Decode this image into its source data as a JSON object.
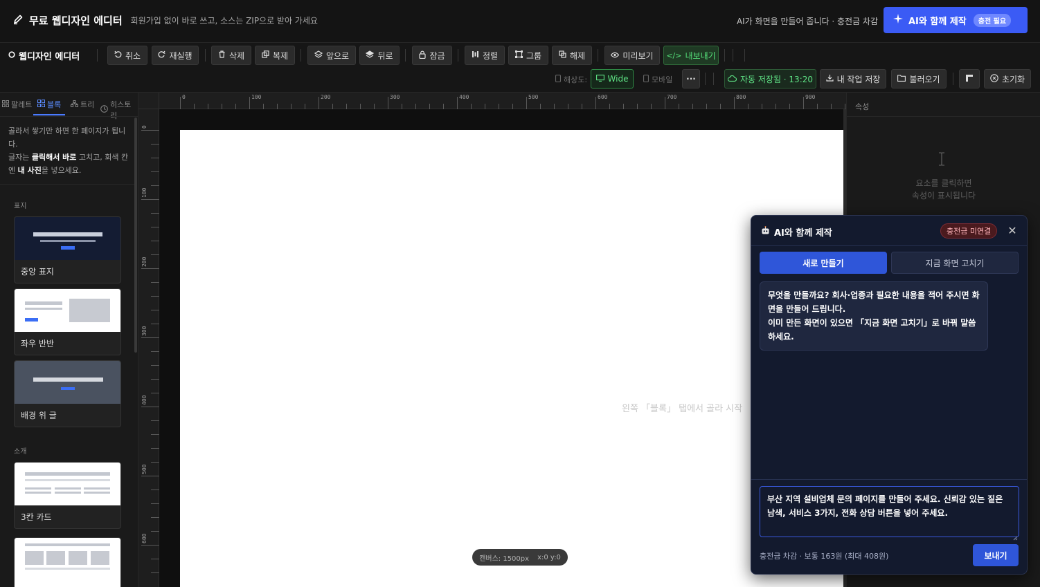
{
  "header": {
    "title": "무료 웹디자인 에디터",
    "subtitle": "회원가입 없이 바로 쓰고, 소스는 ZIP으로 받아 가세요",
    "ai_note": "AI가 화면을 만들어 줍니다 · 충전금 차감",
    "ai_button": "AI와 함께 제작",
    "ai_badge": "충전 필요"
  },
  "toolbar": {
    "editor_title": "웹디자인 에디터",
    "undo": "취소",
    "redo": "재실행",
    "delete": "삭제",
    "duplicate": "복제",
    "forward": "앞으로",
    "backward": "뒤로",
    "lock": "잠금",
    "align": "정렬",
    "group": "그룹",
    "ungroup": "해제",
    "preview": "미리보기",
    "export": "내보내기",
    "resolution_label": "해상도:",
    "wide": "Wide",
    "mobile": "모바일",
    "more": "···",
    "autosave": "자동 저장됨 · 13:20",
    "save_my": "내 작업 저장",
    "load": "불러오기",
    "reset": "초기화"
  },
  "left": {
    "tabs": [
      "팔레트",
      "블록",
      "트리",
      "히스토리"
    ],
    "active_tab": "블록",
    "hint_line1": "골라서 쌓기만 하면 한 페이지가 됩니다.",
    "hint_line2_a": "글자는 ",
    "hint_line2_b": "클릭해서 바로",
    "hint_line2_c": " 고치고, 회색 칸엔 ",
    "hint_line2_d": "내 사진",
    "hint_line2_e": "을 넣으세요.",
    "section_cover": "표지",
    "section_intro": "소개",
    "blocks": [
      "중앙 표지",
      "좌우 반반",
      "배경 위 글",
      "3칸 카드"
    ]
  },
  "canvas": {
    "ruler_x": [
      "0",
      "100",
      "200",
      "300",
      "400",
      "500",
      "600",
      "700",
      "800",
      "900"
    ],
    "ruler_y": [
      "0",
      "100",
      "200",
      "300",
      "400",
      "500",
      "600"
    ],
    "placeholder": "왼쪽 「블록」 탭에서 골라 시작",
    "status_size": "캔버스: 1500px",
    "status_xy": "x:0 y:0"
  },
  "properties": {
    "title": "속성",
    "empty_line1": "요소를 클릭하면",
    "empty_line2": "속성이 표시됩니다"
  },
  "ai_panel": {
    "title": "AI와 함께 제작",
    "credit_status": "충전금 미연결",
    "tab_new": "새로 만들기",
    "tab_fix": "지금 화면 고치기",
    "message": "무엇을 만들까요? 회사·업종과 필요한 내용을 적어 주시면 화면을 만들어 드립니다.\n이미 만든 화면이 있으면 「지금 화면 고치기」로 바꿔 말씀하세요.",
    "input_value": "부산 지역 설비업체 문의 페이지를 만들어 주세요. 신뢰감 있는 짙은 남색, 서비스 3가지, 전화 상담 버튼을 넣어 주세요.",
    "cost": "충전금 차감 · 보통 163원 (최대 408원)",
    "send": "보내기"
  },
  "colors": {
    "accent": "#3b5bf5",
    "export_green": "#2ecc71",
    "credit_red": "#ffb3b9"
  }
}
